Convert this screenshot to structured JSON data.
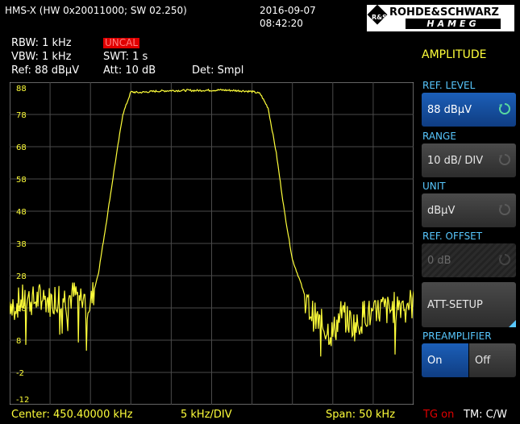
{
  "header": {
    "device": "HMS-X (HW 0x20011000; SW 02.250)",
    "date": "2016-09-07",
    "time": "08:42:20",
    "brand_top": "ROHDE&SCHWARZ",
    "brand_bottom": "HAMEG"
  },
  "params": {
    "rbw": "RBW: 1 kHz",
    "vbw": "VBW: 1 kHz",
    "ref": "Ref: 88 dBµV",
    "uncal": "UNCAL",
    "swt": "SWT: 1 s",
    "att": "Att: 10 dB",
    "det": "Det: Smpl"
  },
  "footer": {
    "center": "Center: 450.40000 kHz",
    "div": "5 kHz/DIV",
    "span": "Span: 50 kHz",
    "tg": "TG on",
    "tm": "TM: C/W"
  },
  "menu": {
    "title": "AMPLITUDE",
    "ref_level_label": "REF. LEVEL",
    "ref_level_value": "88 dBµV",
    "range_label": "RANGE",
    "range_value": "10 dB/ DIV",
    "unit_label": "UNIT",
    "unit_value": "dBµV",
    "ref_offset_label": "REF. OFFSET",
    "ref_offset_value": "0 dB",
    "att_setup": "ATT-SETUP",
    "preamp_label": "PREAMPLIFIER",
    "preamp_on": "On",
    "preamp_off": "Off"
  },
  "colors": {
    "trace": "#ffff3a",
    "accent": "#58c8ff",
    "alert": "#e00000",
    "active": "#1c5fb8"
  },
  "chart_data": {
    "type": "line",
    "y_tick_labels": [
      "88",
      "78",
      "68",
      "58",
      "48",
      "38",
      "28",
      "18",
      "8",
      "-2",
      "-12"
    ],
    "ylim": [
      -12,
      88
    ],
    "grid": true,
    "xlim": [
      -25,
      25
    ],
    "series": [
      {
        "points": [
          [
            -25,
            20
          ],
          [
            -24,
            19.5
          ],
          [
            -23,
            21
          ],
          [
            -22,
            20
          ],
          [
            -21,
            21.5
          ],
          [
            -20,
            20
          ],
          [
            -19,
            22
          ],
          [
            -18,
            21
          ],
          [
            -17,
            22
          ],
          [
            -16,
            21
          ],
          [
            -15,
            19
          ],
          [
            -14,
            29
          ],
          [
            -13,
            45
          ],
          [
            -12,
            62
          ],
          [
            -11,
            78
          ],
          [
            -10,
            85
          ],
          [
            -9,
            84.8
          ],
          [
            -8,
            85
          ],
          [
            -7,
            85.2
          ],
          [
            -6,
            85.3
          ],
          [
            -5,
            85.4
          ],
          [
            -4,
            85.4
          ],
          [
            -3,
            85.5
          ],
          [
            -2,
            85.4
          ],
          [
            -1,
            85.5
          ],
          [
            0,
            85.5
          ],
          [
            1,
            85.6
          ],
          [
            2,
            85.5
          ],
          [
            3,
            85.4
          ],
          [
            4,
            85.3
          ],
          [
            5,
            85.1
          ],
          [
            6,
            84.5
          ],
          [
            7,
            80
          ],
          [
            8,
            66
          ],
          [
            9,
            48
          ],
          [
            10,
            33
          ],
          [
            11,
            26
          ],
          [
            12,
            18
          ],
          [
            13,
            14
          ],
          [
            14,
            12
          ],
          [
            15,
            10
          ],
          [
            16,
            16
          ],
          [
            17,
            14
          ],
          [
            18,
            12
          ],
          [
            19,
            17
          ],
          [
            20,
            15
          ],
          [
            21,
            18
          ],
          [
            22,
            17
          ],
          [
            23,
            19
          ],
          [
            24,
            20
          ],
          [
            25,
            19
          ]
        ]
      }
    ]
  }
}
